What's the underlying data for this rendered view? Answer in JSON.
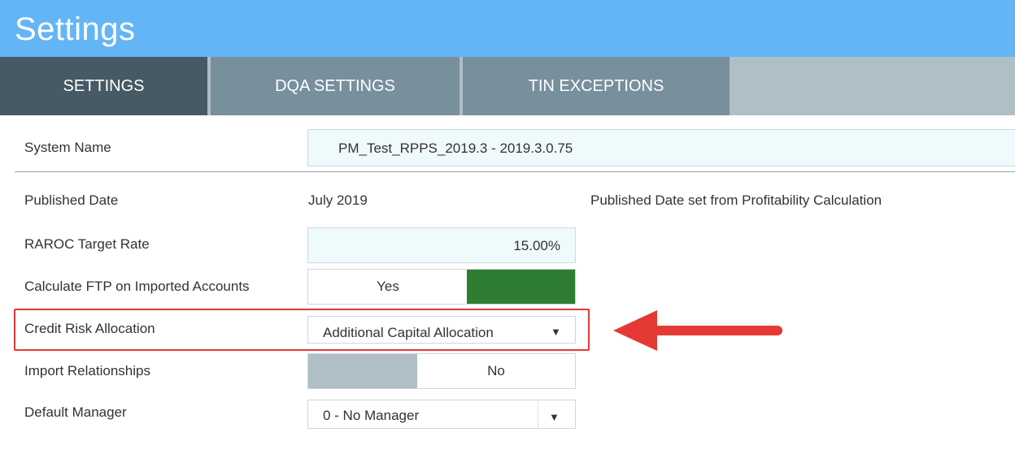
{
  "header": {
    "title": "Settings"
  },
  "tabs": [
    {
      "label": "SETTINGS",
      "active": true
    },
    {
      "label": "DQA SETTINGS",
      "active": false
    },
    {
      "label": "TIN EXCEPTIONS",
      "active": false
    }
  ],
  "rows": {
    "system_name": {
      "label": "System Name",
      "value": "PM_Test_RPPS_2019.3 -  2019.3.0.75"
    },
    "published_date": {
      "label": "Published Date",
      "value": "July 2019",
      "note": "Published Date set from Profitability Calculation"
    },
    "raroc": {
      "label": "RAROC Target Rate",
      "value": "15.00%"
    },
    "calc_ftp": {
      "label": "Calculate FTP on Imported Accounts",
      "value": "Yes"
    },
    "credit_risk": {
      "label": "Credit Risk Allocation",
      "value": "Additional Capital Allocation"
    },
    "import_rel": {
      "label": "Import Relationships",
      "value": "No"
    },
    "default_manager": {
      "label": "Default Manager",
      "value": "0 - No Manager"
    }
  },
  "colors": {
    "header": "#64b5f6",
    "tab_active": "#455a64",
    "tab_inactive": "#78909c",
    "toggle_on": "#2e7d32",
    "highlight": "#e53935"
  },
  "icons": {
    "dropdown": "caret-down-icon",
    "annotation": "red-arrow-icon"
  }
}
